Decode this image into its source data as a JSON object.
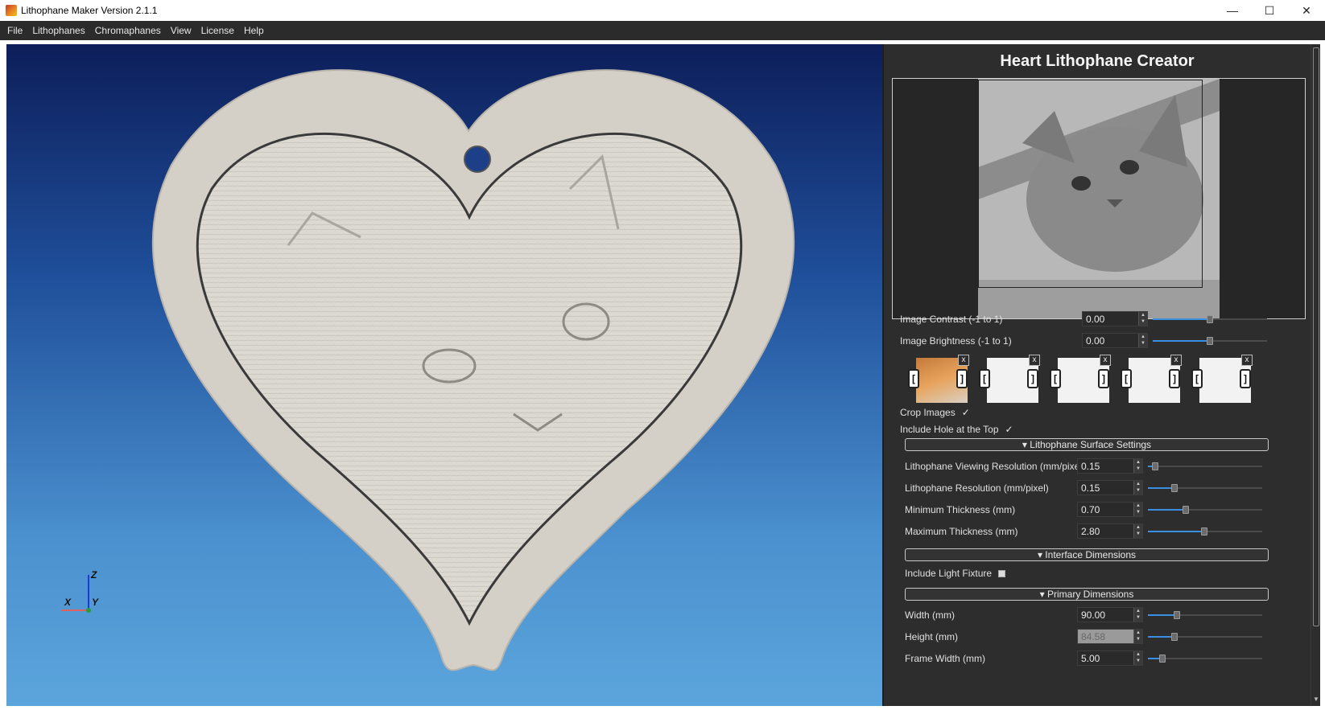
{
  "window": {
    "title": "Lithophane Maker Version 2.1.1",
    "minimize": "—",
    "maximize": "☐",
    "close": "✕"
  },
  "menu": [
    "File",
    "Lithophanes",
    "Chromaphanes",
    "View",
    "License",
    "Help"
  ],
  "viewport": {
    "axis_x": "X",
    "axis_y": "Y",
    "axis_z": "Z"
  },
  "panel": {
    "title": "Heart Lithophane Creator",
    "contrast": {
      "label": "Image Contrast (-1 to 1)",
      "value": "0.00",
      "level": 0.5
    },
    "brightness": {
      "label": "Image Brightness (-1 to 1)",
      "value": "0.00",
      "level": 0.5
    },
    "thumb_close": "x",
    "thumb_prev": "[",
    "thumb_next": "]",
    "crop_images": {
      "label": "Crop Images",
      "mark": "✓"
    },
    "include_hole": {
      "label": "Include Hole at the Top",
      "mark": "✓"
    },
    "surface_section": "▾  Lithophane Surface Settings",
    "surface": [
      {
        "label": "Lithophane Viewing Resolution (mm/pixe",
        "value": "0.15",
        "level": 0.06
      },
      {
        "label": "Lithophane Resolution (mm/pixel)",
        "value": "0.15",
        "level": 0.23
      },
      {
        "label": "Minimum Thickness (mm)",
        "value": "0.70",
        "level": 0.33
      },
      {
        "label": "Maximum Thickness (mm)",
        "value": "2.80",
        "level": 0.49
      }
    ],
    "interface_section": "▾  Interface Dimensions",
    "light_fixture": {
      "label": "Include Light Fixture"
    },
    "primary_section": "▾  Primary Dimensions",
    "primary": [
      {
        "label": "Width (mm)",
        "value": "90.00",
        "level": 0.25
      },
      {
        "label": "Height (mm)",
        "value": "84.58",
        "level": 0.23,
        "disabled": true
      },
      {
        "label": "Frame Width (mm)",
        "value": "5.00",
        "level": 0.13
      }
    ]
  }
}
